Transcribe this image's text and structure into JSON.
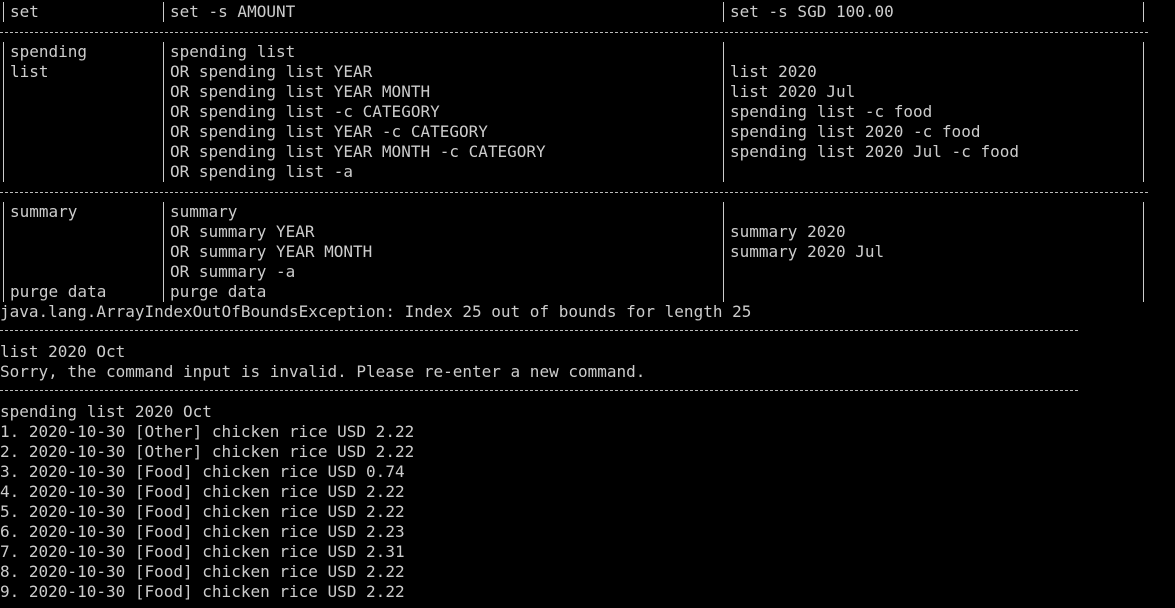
{
  "table": {
    "set_row": {
      "command": "set",
      "format": "set -s AMOUNT",
      "example": "set -s SGD 100.00"
    },
    "spending_row": {
      "command_line1": "spending",
      "command_line2": "list",
      "formats": [
        "spending list",
        "OR spending list YEAR",
        "OR spending list YEAR MONTH",
        "OR spending list -c CATEGORY",
        "OR spending list YEAR -c CATEGORY",
        "OR spending list YEAR MONTH -c CATEGORY",
        "OR spending list -a"
      ],
      "examples": [
        "list 2020",
        "list 2020 Jul",
        "spending list -c food",
        "spending list 2020 -c food",
        "spending list 2020 Jul -c food"
      ]
    },
    "summary_row": {
      "command": "summary",
      "formats": [
        "summary",
        "OR summary YEAR",
        "OR summary YEAR MONTH",
        "OR summary -a"
      ],
      "examples": [
        "summary 2020",
        "summary 2020 Jul"
      ]
    },
    "purge_row": {
      "command": "purge data",
      "format": "purge data"
    }
  },
  "output": {
    "exception": "java.lang.ArrayIndexOutOfBoundsException: Index 25 out of bounds for length 25",
    "command1": "list 2020 Oct",
    "error": "Sorry, the command input is invalid. Please re-enter a new command.",
    "command2": "spending list 2020 Oct",
    "items": [
      "1. 2020-10-30 [Other] chicken rice USD 2.22",
      "2. 2020-10-30 [Other] chicken rice USD 2.22",
      "3. 2020-10-30 [Food] chicken rice USD 0.74",
      "4. 2020-10-30 [Food] chicken rice USD 2.22",
      "5. 2020-10-30 [Food] chicken rice USD 2.22",
      "6. 2020-10-30 [Food] chicken rice USD 2.23",
      "7. 2020-10-30 [Food] chicken rice USD 2.31",
      "8. 2020-10-30 [Food] chicken rice USD 2.22",
      "9. 2020-10-30 [Food] chicken rice USD 2.22"
    ]
  },
  "colors": {
    "background": "#000000",
    "text": "#cccccc"
  }
}
